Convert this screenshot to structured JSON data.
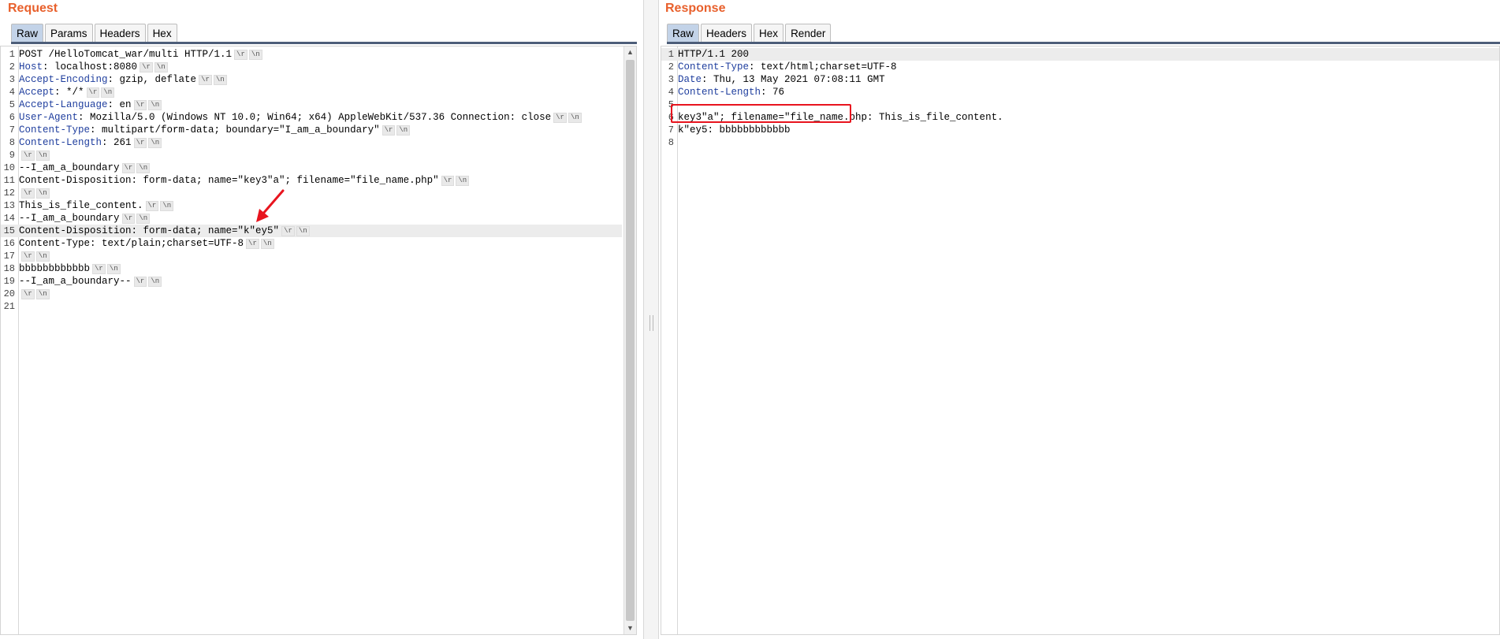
{
  "request": {
    "title": "Request",
    "tabs": [
      {
        "label": "Raw",
        "active": true
      },
      {
        "label": "Params",
        "active": false
      },
      {
        "label": "Headers",
        "active": false
      },
      {
        "label": "Hex",
        "active": false
      }
    ],
    "lines": [
      {
        "n": "1",
        "key": "",
        "sep": "",
        "value": "POST /HelloTomcat_war/multi HTTP/1.1",
        "crlf": true
      },
      {
        "n": "2",
        "key": "Host",
        "sep": ": ",
        "value": "localhost:8080",
        "crlf": true
      },
      {
        "n": "3",
        "key": "Accept-Encoding",
        "sep": ": ",
        "value": "gzip, deflate",
        "crlf": true
      },
      {
        "n": "4",
        "key": "Accept",
        "sep": ": ",
        "value": "*/*",
        "crlf": true
      },
      {
        "n": "5",
        "key": "Accept-Language",
        "sep": ": ",
        "value": "en",
        "crlf": true
      },
      {
        "n": "6",
        "key": "User-Agent",
        "sep": ": ",
        "value": "Mozilla/5.0 (Windows NT 10.0; Win64; x64) AppleWebKit/537.36 Connection: close",
        "crlf": true
      },
      {
        "n": "7",
        "key": "Content-Type",
        "sep": ": ",
        "value": "multipart/form-data; boundary=\"I_am_a_boundary\"",
        "crlf": true
      },
      {
        "n": "8",
        "key": "Content-Length",
        "sep": ": ",
        "value": "261",
        "crlf": true
      },
      {
        "n": "9",
        "key": "",
        "sep": "",
        "value": "",
        "crlf": true
      },
      {
        "n": "10",
        "key": "",
        "sep": "",
        "value": "--I_am_a_boundary",
        "crlf": true
      },
      {
        "n": "11",
        "key": "",
        "sep": "",
        "value": "Content-Disposition: form-data; name=\"key3\"a\"; filename=\"file_name.php\"",
        "crlf": true
      },
      {
        "n": "12",
        "key": "",
        "sep": "",
        "value": "",
        "crlf": true
      },
      {
        "n": "13",
        "key": "",
        "sep": "",
        "value": "This_is_file_content.",
        "crlf": true
      },
      {
        "n": "14",
        "key": "",
        "sep": "",
        "value": "--I_am_a_boundary",
        "crlf": true
      },
      {
        "n": "15",
        "key": "",
        "sep": "",
        "value": "Content-Disposition: form-data; name=\"k\"ey5\"",
        "crlf": true,
        "highlight": true
      },
      {
        "n": "16",
        "key": "",
        "sep": "",
        "value": "Content-Type: text/plain;charset=UTF-8",
        "crlf": true
      },
      {
        "n": "17",
        "key": "",
        "sep": "",
        "value": "",
        "crlf": true
      },
      {
        "n": "18",
        "key": "",
        "sep": "",
        "value": "bbbbbbbbbbbb",
        "crlf": true
      },
      {
        "n": "19",
        "key": "",
        "sep": "",
        "value": "--I_am_a_boundary--",
        "crlf": true
      },
      {
        "n": "20",
        "key": "",
        "sep": "",
        "value": "",
        "crlf": true
      },
      {
        "n": "21",
        "key": "",
        "sep": "",
        "value": "",
        "crlf": false
      }
    ]
  },
  "response": {
    "title": "Response",
    "tabs": [
      {
        "label": "Raw",
        "active": true
      },
      {
        "label": "Headers",
        "active": false
      },
      {
        "label": "Hex",
        "active": false
      },
      {
        "label": "Render",
        "active": false
      }
    ],
    "lines": [
      {
        "n": "1",
        "key": "",
        "sep": "",
        "value": "HTTP/1.1 200",
        "crlf": false,
        "highlight": true
      },
      {
        "n": "2",
        "key": "Content-Type",
        "sep": ": ",
        "value": "text/html;charset=UTF-8",
        "crlf": false
      },
      {
        "n": "3",
        "key": "Date",
        "sep": ": ",
        "value": "Thu, 13 May 2021 07:08:11 GMT",
        "crlf": false
      },
      {
        "n": "4",
        "key": "Content-Length",
        "sep": ": ",
        "value": "76",
        "crlf": false
      },
      {
        "n": "5",
        "key": "",
        "sep": "",
        "value": "",
        "crlf": false
      },
      {
        "n": "6",
        "key": "",
        "sep": "",
        "value": "key3\"a\"; filename=\"file_name.php: This_is_file_content.",
        "crlf": false
      },
      {
        "n": "7",
        "key": "",
        "sep": "",
        "value": "k\"ey5: bbbbbbbbbbbb",
        "crlf": false
      },
      {
        "n": "8",
        "key": "",
        "sep": "",
        "value": "",
        "crlf": false
      }
    ]
  },
  "crlf_tokens": [
    "\\r",
    "\\n"
  ],
  "colors": {
    "title": "#e8602c",
    "header_key": "#1f3e9e",
    "annotation": "#e8141e",
    "active_tab": "#c3d3e8"
  },
  "annotations": {
    "request_arrow": "red-arrow-icon",
    "response_box": "red-highlight-box"
  }
}
